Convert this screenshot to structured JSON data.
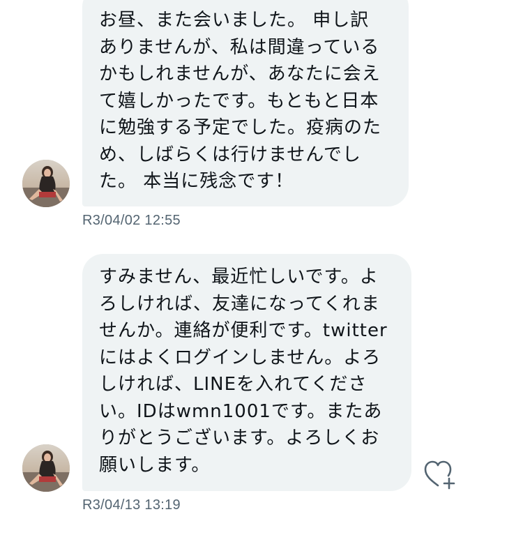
{
  "messages": [
    {
      "lines": [
        "お昼、また会いました。 申し訳",
        "ありませんが、私は間違っている",
        "かもしれませんが、あなたに会え",
        "て嬉しかったです。もともと日本",
        "に勉強する予定でした。疫病のた",
        "め、しばらくは行けませんでし",
        "た。 本当に残念です！"
      ],
      "timestamp": "R3/04/02 12:55",
      "avatar_icon": "profile-photo"
    },
    {
      "lines": [
        "すみません、最近忙しいです。よ",
        "ろしければ、友達になってくれま",
        "せんか。連絡が便利です。twitter",
        "にはよくログインしません。よろ",
        "しければ、LINEを入れてくださ",
        "い。IDはwmn1001です。またあ",
        "りがとうございます。よろしくお",
        "願いします。"
      ],
      "timestamp": "R3/04/13 13:19",
      "avatar_icon": "profile-photo",
      "reaction_icon": "heart-plus-icon"
    }
  ],
  "colors": {
    "bubble_bg": "#eff3f4",
    "text": "#0f1419",
    "timestamp": "#536471",
    "icon": "#536471"
  }
}
